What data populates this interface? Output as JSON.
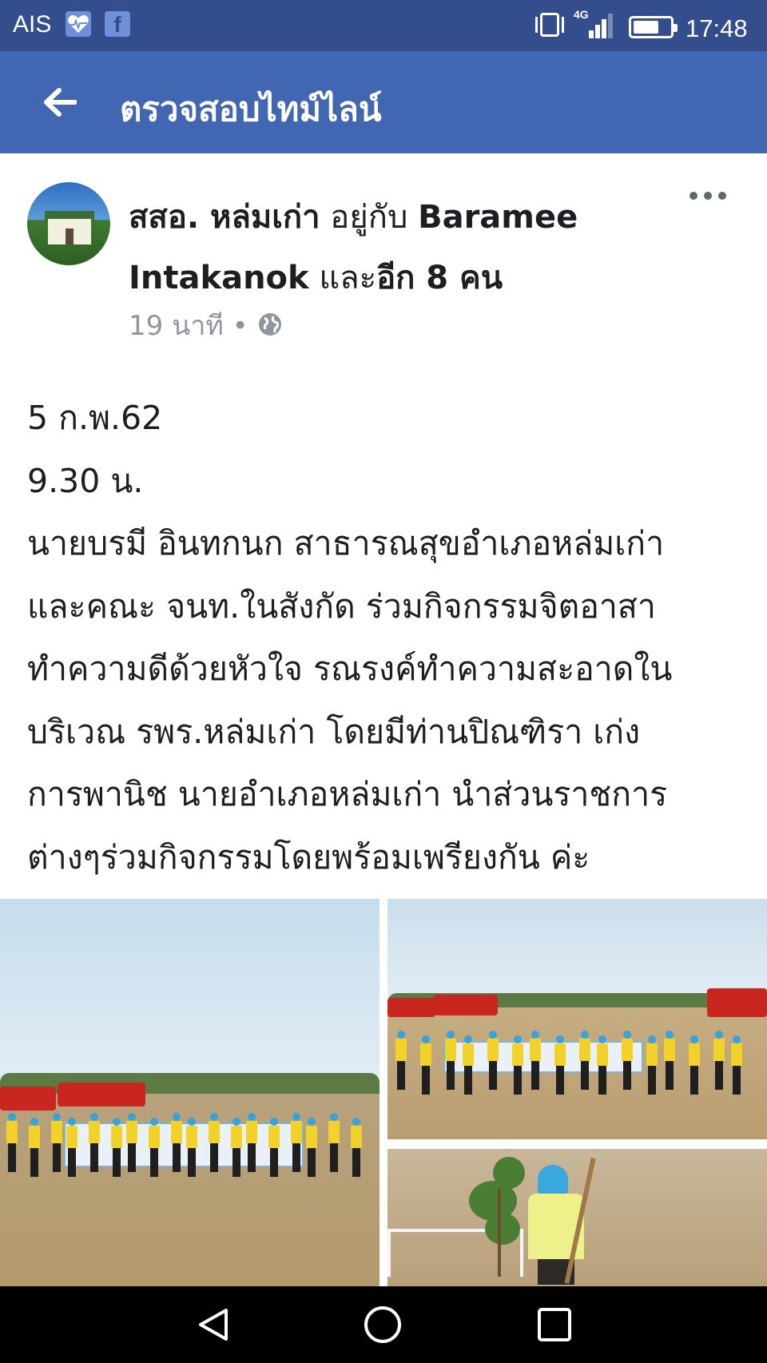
{
  "status_bar": {
    "carrier": "AIS",
    "notification_icons": [
      "health-icon",
      "facebook-icon"
    ],
    "network": "4G",
    "signal_level": 0.75,
    "battery_level": 0.7,
    "time": "17:48"
  },
  "app_bar": {
    "back_icon": "back-arrow-icon",
    "title": "ตรวจสอบไทม์ไลน์",
    "color": "#4267b2"
  },
  "post": {
    "author": {
      "page_name": "สสอ. หล่มเก่า",
      "with_text": "อยู่กับ",
      "tagged_name": "Baramee Intakanok",
      "and_text": "และ",
      "others": "อีก 8 คน"
    },
    "meta": {
      "time_ago": "19 นาที",
      "separator": "•",
      "privacy_icon": "globe-icon"
    },
    "text_lines": [
      "5 ก.พ.62",
      "9.30 น.",
      "นายบรมี อินทกนก สาธารณสุขอำเภอหล่มเก่า",
      "และคณะ จนท.ในสังกัด ร่วมกิจกรรมจิตอาสา",
      "ทำความดีด้วยหัวใจ รณรงค์ทำความสะอาดใน",
      "บริเวณ รพร.หล่มเก่า โดยมีท่านปิณฑิรา เก่ง",
      "การพานิช นายอำเภอหล่มเก่า นำส่วนราชการ",
      "ต่างๆร่วมกิจกรรมโดยพร้อมเพรียงกัน ค่ะ"
    ],
    "photos": [
      "group-photo-field",
      "group-photo-trucks",
      "tree-planting-photo"
    ]
  },
  "nav_bar": {
    "buttons": [
      "back-triangle-icon",
      "home-circle-icon",
      "recents-square-icon"
    ]
  }
}
